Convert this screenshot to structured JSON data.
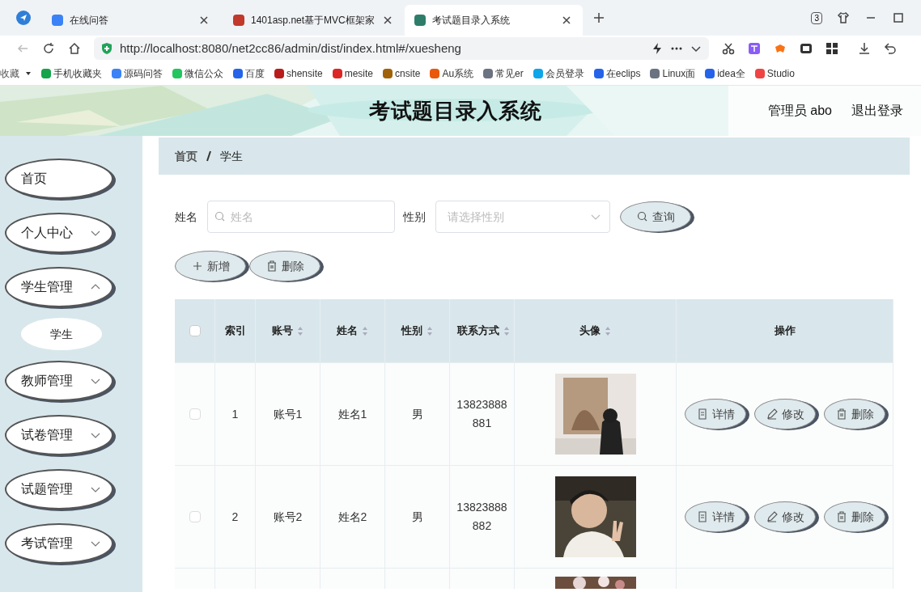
{
  "browser": {
    "tabs": [
      {
        "title": "在线问答",
        "selected": false,
        "color": "#3b82f6"
      },
      {
        "title": "1401asp.net基于MVC框架家",
        "selected": false,
        "color": "#c0392b"
      },
      {
        "title": "考试题目录入系统",
        "selected": true,
        "color": "#2e7d6b"
      }
    ],
    "tab_count": "3",
    "address": "http://localhost:8080/net2cc86/admin/dist/index.html#/xuesheng",
    "bookmarks": [
      {
        "label": "收藏",
        "color": "#555555"
      },
      {
        "label": "手机收藏夹",
        "color": "#16a34a"
      },
      {
        "label": "源码问答",
        "color": "#3b82f6"
      },
      {
        "label": "微信公众",
        "color": "#22c55e"
      },
      {
        "label": "百度",
        "color": "#2563eb"
      },
      {
        "label": "shensite",
        "color": "#b91c1c"
      },
      {
        "label": "mesite",
        "color": "#dc2626"
      },
      {
        "label": "cnsite",
        "color": "#a16207"
      },
      {
        "label": "Au系统",
        "color": "#ea580c"
      },
      {
        "label": "常见er",
        "color": "#6b7280"
      },
      {
        "label": "会员登录",
        "color": "#0ea5e9"
      },
      {
        "label": "在eclips",
        "color": "#2563eb"
      },
      {
        "label": "Linux面",
        "color": "#6b7280"
      },
      {
        "label": "idea全",
        "color": "#2563eb"
      },
      {
        "label": "Studio",
        "color": "#ef4444"
      }
    ]
  },
  "header": {
    "title": "考试题目录入系统",
    "user": "管理员 abo",
    "logout": "退出登录"
  },
  "sidebar": {
    "items": [
      {
        "label": "首页",
        "kind": "link"
      },
      {
        "label": "个人中心",
        "kind": "submenu",
        "expanded": false
      },
      {
        "label": "学生管理",
        "kind": "submenu",
        "expanded": true,
        "children": [
          {
            "label": "学生",
            "selected": true
          }
        ]
      },
      {
        "label": "教师管理",
        "kind": "submenu",
        "expanded": false
      },
      {
        "label": "试卷管理",
        "kind": "submenu",
        "expanded": false
      },
      {
        "label": "试题管理",
        "kind": "submenu",
        "expanded": false
      },
      {
        "label": "考试管理",
        "kind": "submenu",
        "expanded": false
      }
    ]
  },
  "breadcrumb": [
    "首页",
    "学生"
  ],
  "search": {
    "name_label": "姓名",
    "name_placeholder": "姓名",
    "gender_label": "性别",
    "gender_placeholder": "请选择性别",
    "button": "查询"
  },
  "actions": [
    "新增",
    "删除"
  ],
  "table": {
    "select_all_checked": false,
    "columns": [
      {
        "label": "索引",
        "sortable": false
      },
      {
        "label": "账号",
        "sortable": true
      },
      {
        "label": "姓名",
        "sortable": true
      },
      {
        "label": "性别",
        "sortable": true
      },
      {
        "label": "联系方式",
        "sortable": true
      },
      {
        "label": "头像",
        "sortable": true
      },
      {
        "label": "操作",
        "sortable": false
      }
    ],
    "rows": [
      {
        "checked": false,
        "cells": [
          "1",
          "账号1",
          "姓名1",
          "男",
          "13823888881"
        ],
        "avatar": {
          "kind": "picture"
        },
        "actions": [
          "详情",
          "修改",
          "删除"
        ]
      },
      {
        "checked": false,
        "cells": [
          "2",
          "账号2",
          "姓名2",
          "男",
          "13823888882"
        ],
        "avatar": {
          "kind": "picture"
        },
        "actions": [
          "详情",
          "修改",
          "删除"
        ]
      },
      {
        "avatar": {
          "kind": "picture"
        }
      }
    ]
  }
}
